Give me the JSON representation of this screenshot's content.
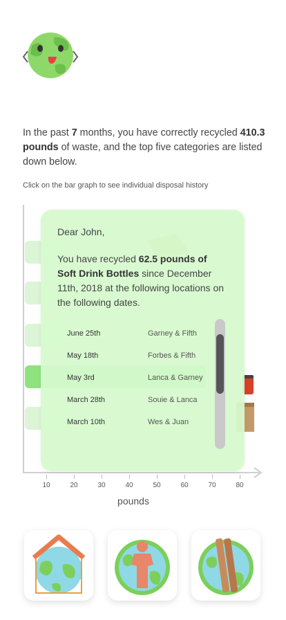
{
  "intro": {
    "p1": "In the past ",
    "months": "7",
    "p2": " months, you have correctly recycled ",
    "pounds": "410.3  pounds",
    "p3": " of  waste, and the top five categories are listed down below."
  },
  "hint": "Click on the bar graph to see individual  disposal history",
  "chart_data": {
    "type": "bar",
    "orientation": "horizontal",
    "xlabel": "pounds",
    "xticks": [
      10,
      20,
      30,
      40,
      50,
      60,
      70,
      80
    ],
    "selected_index": 3,
    "categories": [],
    "values": []
  },
  "popup": {
    "greeting": "Dear John,",
    "msg_p1": "You have recycled ",
    "msg_amount": "62.5 pounds of",
    "msg_category": "Soft Drink Bottles",
    "msg_p2": " since December 11th, 2018 at the following locations on the following dates.",
    "rows": [
      {
        "date": "June 25th",
        "location": "Garney & Fifth"
      },
      {
        "date": "May 18th",
        "location": "Forbes & Fifth"
      },
      {
        "date": "May 3rd",
        "location": "Lanca & Garney"
      },
      {
        "date": "March 28th",
        "location": "Souie & Lanca"
      },
      {
        "date": "March 10th",
        "location": "Wes & Juan"
      }
    ]
  },
  "cards": [
    {
      "icon": "earth-house-icon"
    },
    {
      "icon": "earth-person-icon"
    },
    {
      "icon": "earth-wood-icon"
    }
  ],
  "colors": {
    "accent": "#8fe37f",
    "bar": "#dcf5d6",
    "popup": "#d6facd",
    "earth_green": "#7ccf5a",
    "earth_blue": "#8fd8e6",
    "person": "#e8866a",
    "roof": "#e87c4e",
    "wood": "#c98a5a"
  }
}
